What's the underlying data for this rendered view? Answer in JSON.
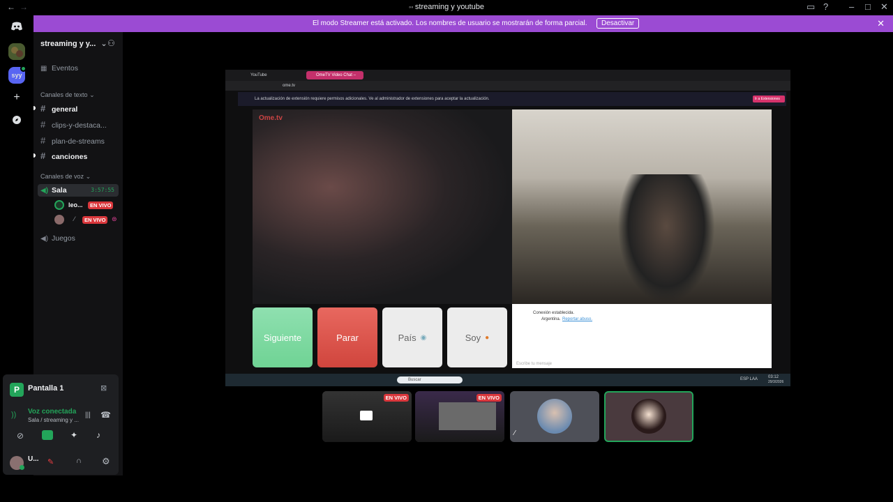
{
  "titlebar": {
    "title": "streaming y youtube",
    "back": "←",
    "forward": "→"
  },
  "banner": {
    "message": "El modo Streamer está activado. Los nombres de usuario se mostrarán de forma parcial.",
    "button": "Desactivar",
    "close": "✕"
  },
  "rail": {
    "server_badge": "syy"
  },
  "server": {
    "name": "streaming y y...",
    "events": "Eventos",
    "text_category": "Canales de texto",
    "text_channels": [
      "general",
      "clips-y-destaca...",
      "plan-de-streams",
      "canciones"
    ],
    "voice_category": "Canales de voz",
    "voice_channel": {
      "name": "Sala",
      "timer": "3:57:55"
    },
    "voice_users": [
      {
        "name": "leo...",
        "badge": "EN VIVO"
      },
      {
        "name": "",
        "badge": "EN VIVO"
      }
    ],
    "voice_channel_2": "Juegos"
  },
  "panel": {
    "screen_title": "Pantalla 1",
    "voice_status": "Voz conectada",
    "voice_location": "Sala / streaming y ...",
    "user_name": "U..."
  },
  "stream": {
    "browser_tabs": [
      "YouTube",
      "OmeTV Video Chat –"
    ],
    "url": "ome.tv",
    "notice": "La actualización de extensión requiere permisos adicionales. Ve al administrador de extensiones para aceptar la actualización.",
    "notice_button": "Ir a Extensiones",
    "logo": "Ome.tv",
    "buttons": [
      "Siguiente",
      "Parar",
      "País",
      "Soy"
    ],
    "chat_status": "Conexión establecida.",
    "chat_country": "Argentina.",
    "chat_report": "Reportar abuso.",
    "chat_placeholder": "Escribe tu mensaje",
    "taskbar_search": "Buscar",
    "taskbar_lang": "ESP LAA",
    "taskbar_time": "03:12",
    "taskbar_date": "29/3/2026"
  },
  "thumbnails": [
    {
      "badge": "EN VIVO"
    },
    {
      "badge": "EN VIVO"
    }
  ],
  "colors": {
    "accent_purple": "#9b4bd3",
    "live_red": "#da373c",
    "green": "#23a55a",
    "blurple": "#5865f2"
  }
}
